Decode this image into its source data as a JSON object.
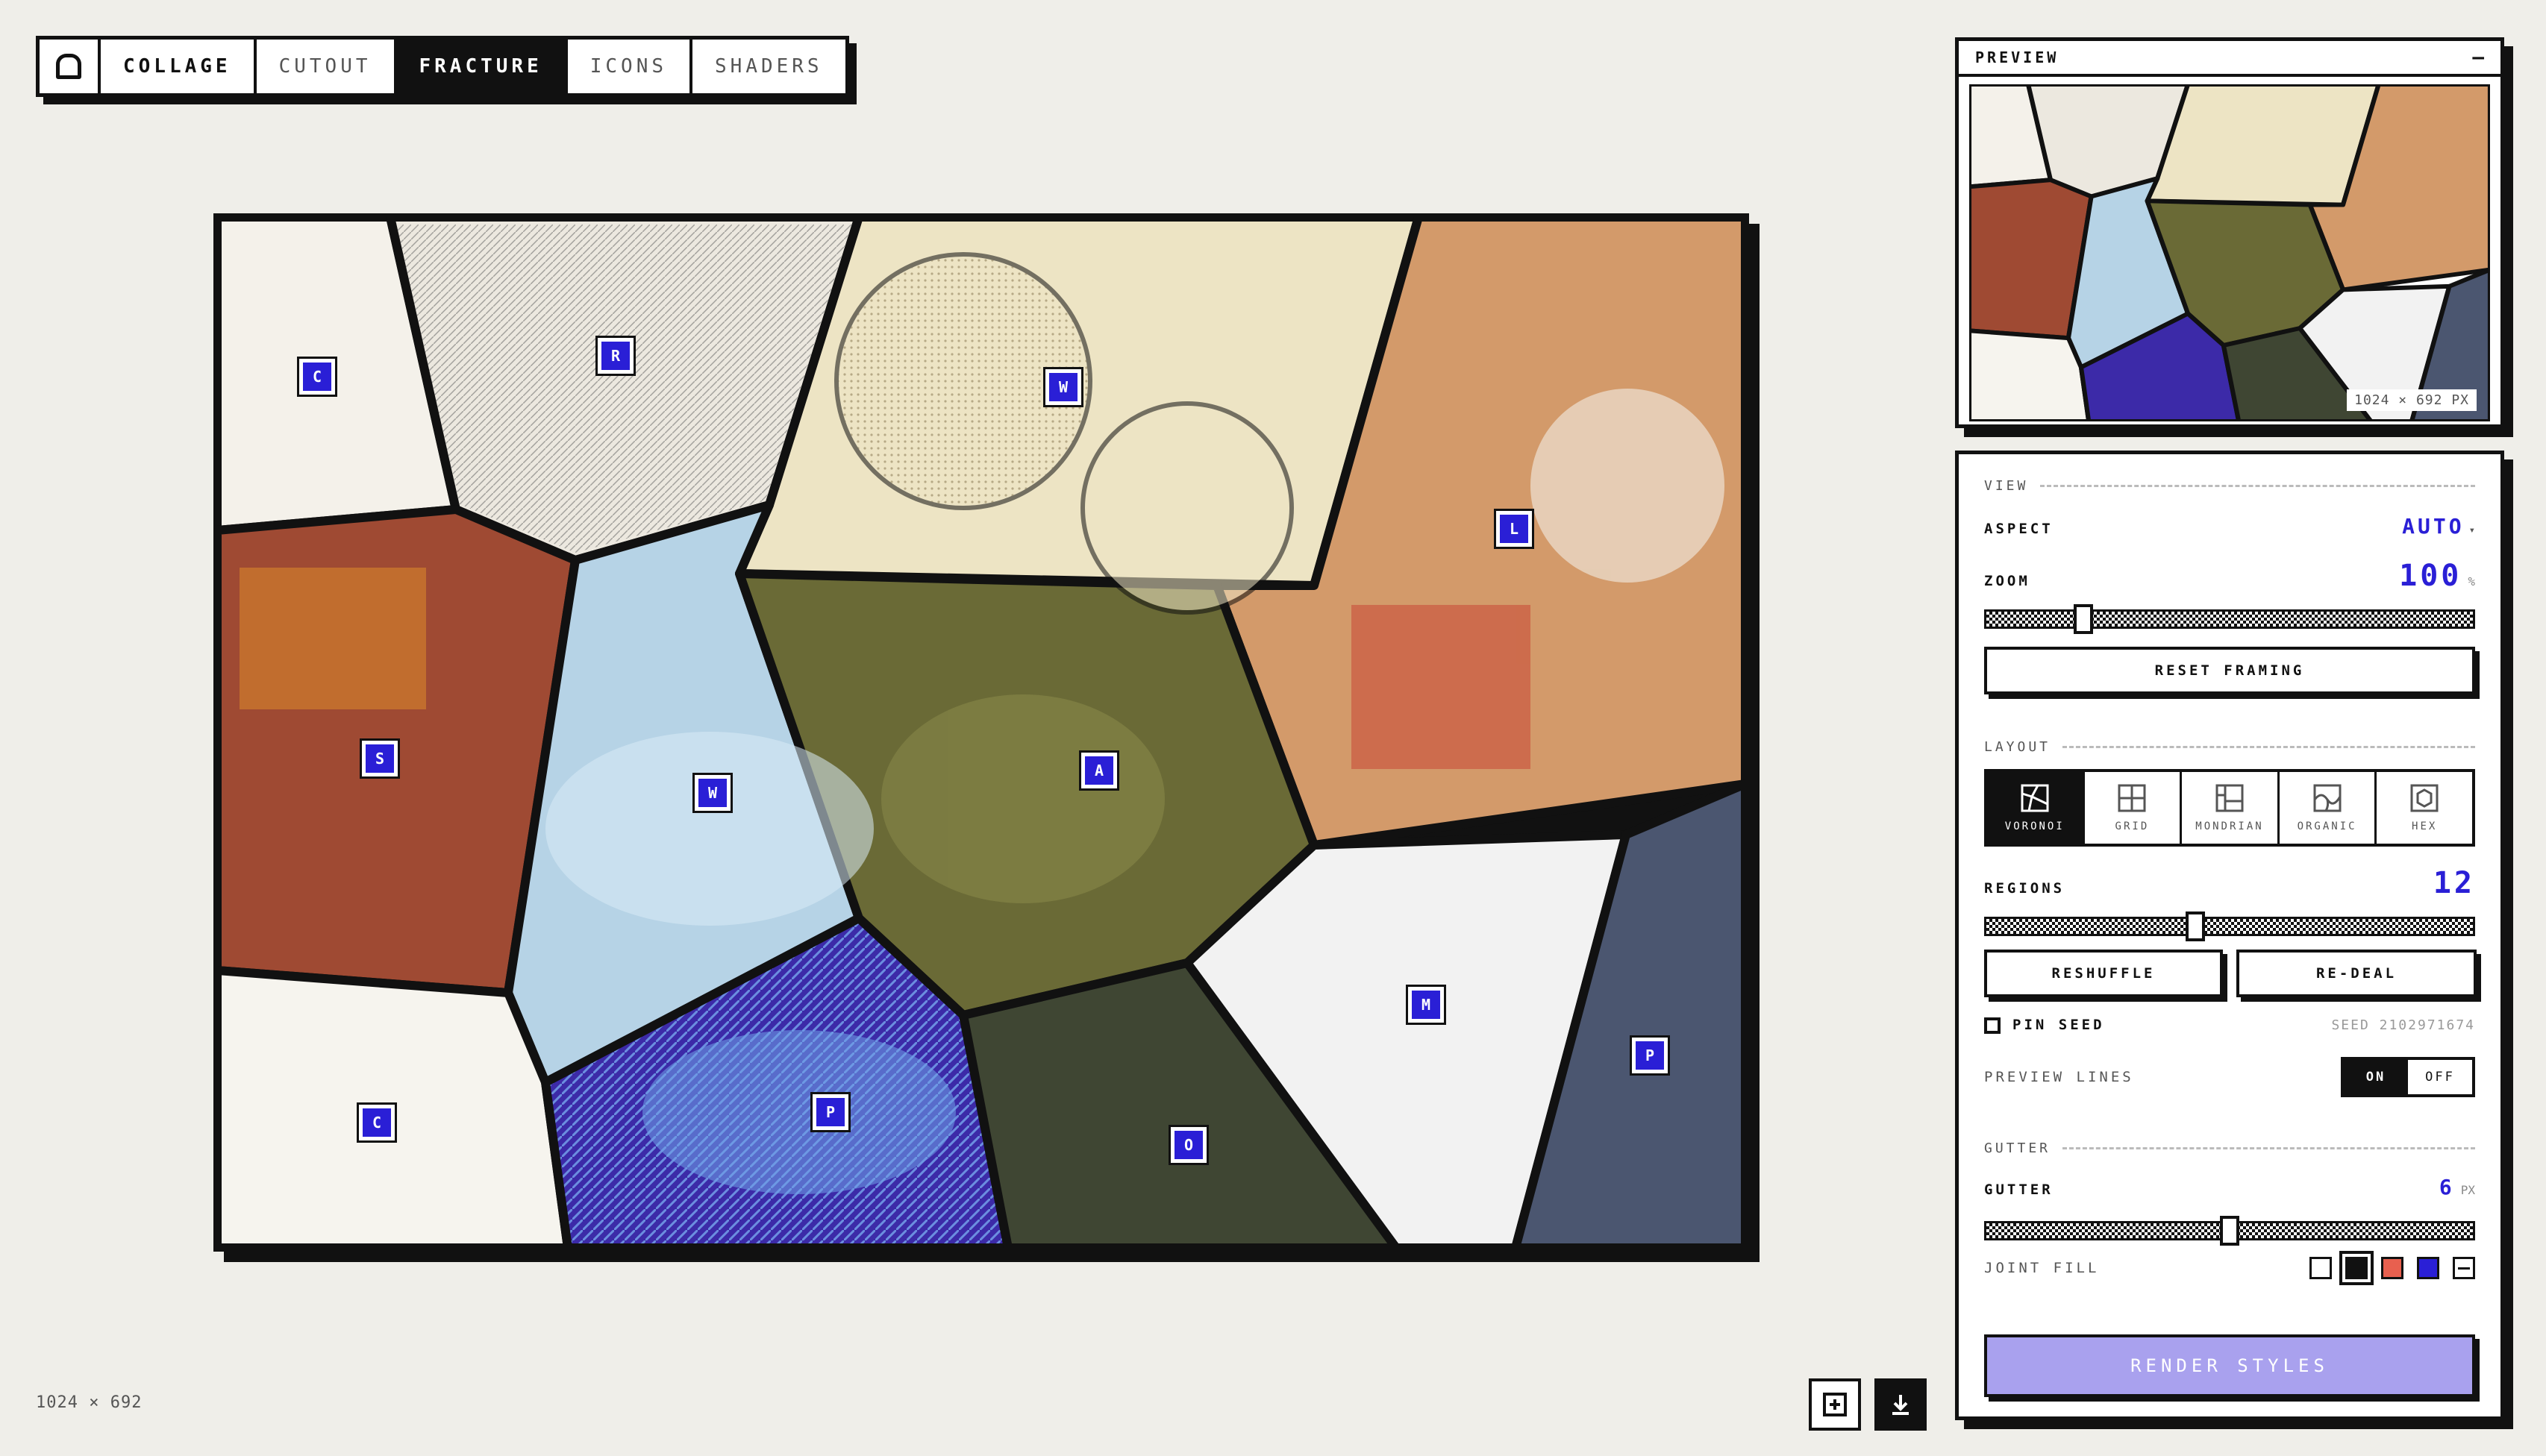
{
  "toolbar": {
    "tabs": [
      {
        "label": "COLLAGE",
        "state": "normal"
      },
      {
        "label": "CUTOUT",
        "state": "dim"
      },
      {
        "label": "FRACTURE",
        "state": "active"
      },
      {
        "label": "ICONS",
        "state": "dim"
      },
      {
        "label": "SHADERS",
        "state": "dim"
      }
    ]
  },
  "canvas": {
    "regions": [
      "C",
      "R",
      "W",
      "L",
      "S",
      "W",
      "A",
      "M",
      "P",
      "C",
      "P",
      "O"
    ]
  },
  "footer": {
    "dimensions": "1024 × 692",
    "add_icon": "add-frame-icon",
    "download_icon": "download-icon"
  },
  "preview": {
    "title": "PREVIEW",
    "minimize": "–",
    "dimensions": "1024 × 692 PX"
  },
  "controls": {
    "view_section": "VIEW",
    "aspect": {
      "label": "ASPECT",
      "value": "AUTO"
    },
    "zoom": {
      "label": "ZOOM",
      "value": "100",
      "unit": "%",
      "slider_fraction": 0.2
    },
    "reset_label": "RESET FRAMING",
    "layout_section": "LAYOUT",
    "layouts": [
      {
        "name": "VORONOI",
        "icon": "voronoi-icon",
        "active": true
      },
      {
        "name": "GRID",
        "icon": "grid-icon",
        "active": false
      },
      {
        "name": "MONDRIAN",
        "icon": "mondrian-icon",
        "active": false
      },
      {
        "name": "ORGANIC",
        "icon": "organic-icon",
        "active": false
      },
      {
        "name": "HEX",
        "icon": "hex-icon",
        "active": false
      }
    ],
    "regions": {
      "label": "REGIONS",
      "value": "12",
      "slider_fraction": 0.43
    },
    "reshuffle_label": "RESHUFFLE",
    "redeal_label": "RE-DEAL",
    "pin_seed_label": "PIN SEED",
    "seed_text": "SEED 2102971674",
    "preview_lines": {
      "label": "PREVIEW LINES",
      "on": "ON",
      "off": "OFF"
    },
    "gutter_section": "GUTTER",
    "gutter": {
      "label": "GUTTER",
      "value": "6",
      "unit": "PX",
      "slider_fraction": 0.5
    },
    "joint_fill": {
      "label": "JOINT FILL",
      "colors": [
        "#ffffff",
        "#111111",
        "#e8604f",
        "#2a1fd6"
      ],
      "selected_index": 1
    },
    "render_label": "RENDER STYLES"
  }
}
